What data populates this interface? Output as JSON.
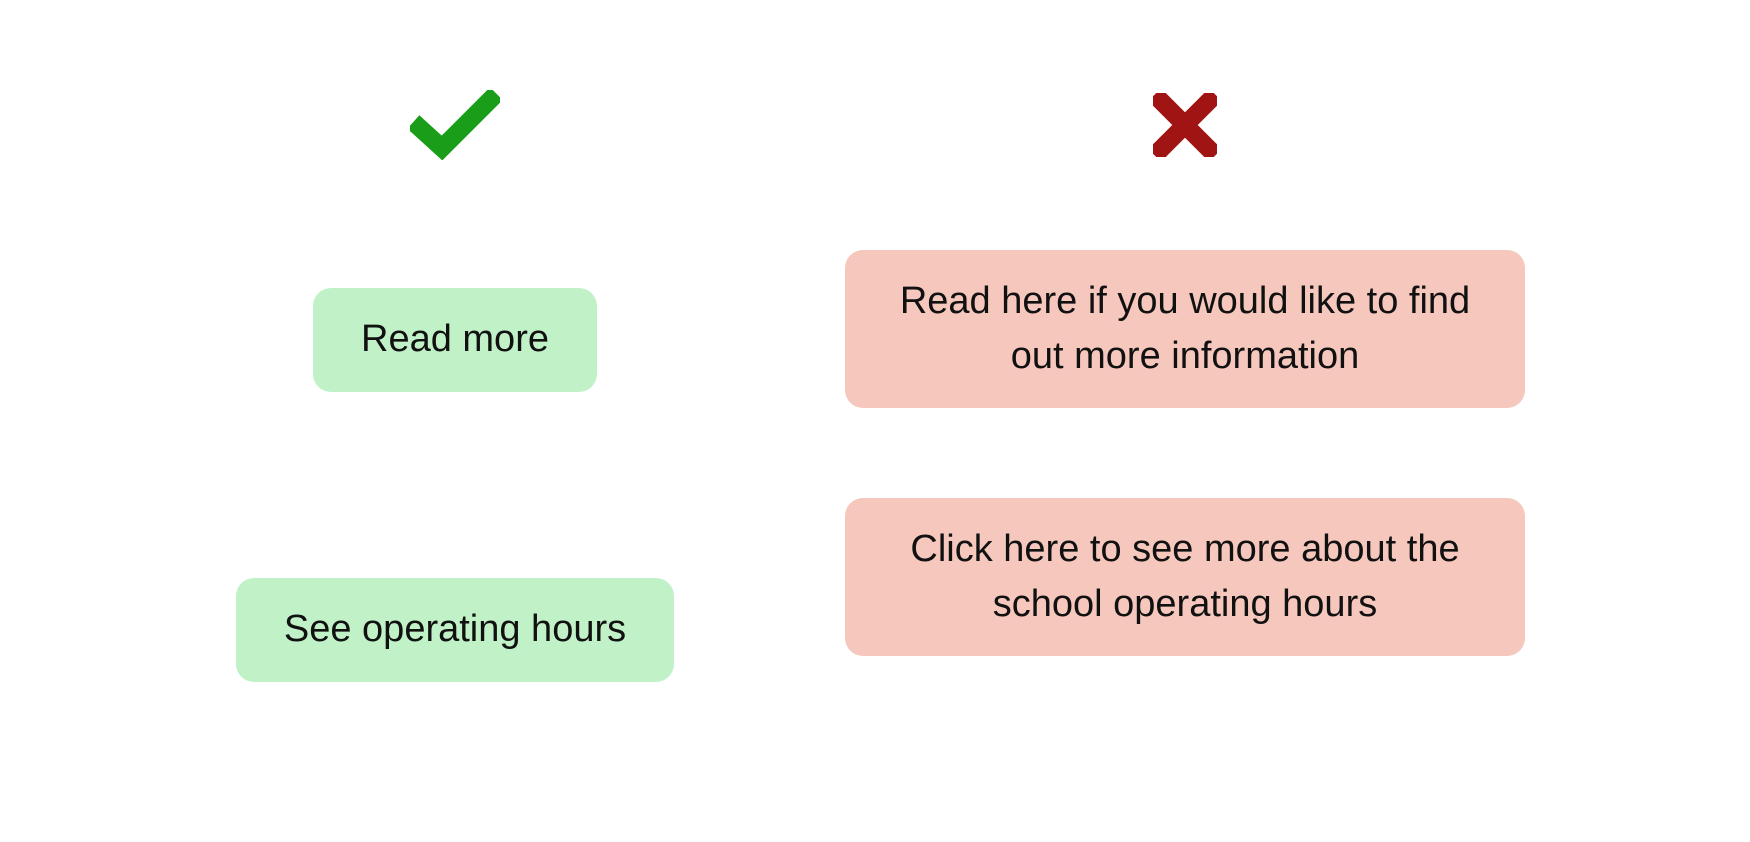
{
  "good": {
    "button1": "Read more",
    "button2": "See operating hours"
  },
  "bad": {
    "button1": "Read here if you would like to find out more information",
    "button2": "Click here to see more about the school operating hours"
  },
  "icons": {
    "good": "check-icon",
    "bad": "cross-icon"
  },
  "colors": {
    "good_icon": "#1a9e1a",
    "bad_icon": "#a01414",
    "good_bg": "#c1f2c7",
    "bad_bg": "#f6c7bd"
  }
}
